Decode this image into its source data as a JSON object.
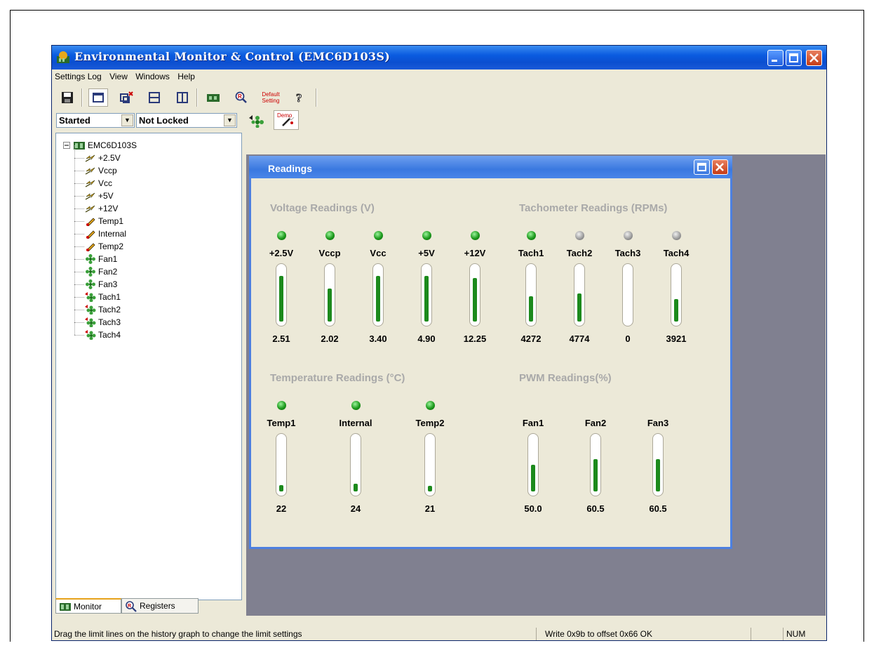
{
  "window": {
    "title": "Environmental Monitor & Control (EMC6D103S)"
  },
  "menu": [
    "Settings Log",
    "View",
    "Windows",
    "Help"
  ],
  "toolbar": {
    "default_setting_line1": "Default",
    "default_setting_line2": "Setting",
    "demo_label": "Demo"
  },
  "combos": {
    "state": "Started",
    "lock": "Not Locked"
  },
  "tree": {
    "root": "EMC6D103S",
    "items": [
      {
        "label": "+2.5V",
        "icon": "voltage-icon"
      },
      {
        "label": "Vccp",
        "icon": "voltage-icon"
      },
      {
        "label": "Vcc",
        "icon": "voltage-icon"
      },
      {
        "label": "+5V",
        "icon": "voltage-icon"
      },
      {
        "label": "+12V",
        "icon": "voltage-icon"
      },
      {
        "label": "Temp1",
        "icon": "thermometer-icon"
      },
      {
        "label": "Internal",
        "icon": "thermometer-icon"
      },
      {
        "label": "Temp2",
        "icon": "thermometer-icon"
      },
      {
        "label": "Fan1",
        "icon": "fan-icon"
      },
      {
        "label": "Fan2",
        "icon": "fan-icon"
      },
      {
        "label": "Fan3",
        "icon": "fan-icon"
      },
      {
        "label": "Tach1",
        "icon": "tach-icon"
      },
      {
        "label": "Tach2",
        "icon": "tach-icon"
      },
      {
        "label": "Tach3",
        "icon": "tach-icon"
      },
      {
        "label": "Tach4",
        "icon": "tach-icon"
      }
    ]
  },
  "tabs": [
    "Monitor",
    "Registers"
  ],
  "readings": {
    "title": "Readings",
    "voltage": {
      "heading": "Voltage Readings (V)",
      "items": [
        {
          "name": "+2.5V",
          "value": "2.51",
          "level": 0.85,
          "led": "green"
        },
        {
          "name": "Vccp",
          "value": "2.02",
          "level": 0.62,
          "led": "green"
        },
        {
          "name": "Vcc",
          "value": "3.40",
          "level": 0.86,
          "led": "green"
        },
        {
          "name": "+5V",
          "value": "4.90",
          "level": 0.85,
          "led": "green"
        },
        {
          "name": "+12V",
          "value": "12.25",
          "level": 0.82,
          "led": "green"
        }
      ]
    },
    "tach": {
      "heading": "Tachometer Readings (RPMs)",
      "items": [
        {
          "name": "Tach1",
          "value": "4272",
          "level": 0.48,
          "led": "green"
        },
        {
          "name": "Tach2",
          "value": "4774",
          "level": 0.52,
          "led": "gray"
        },
        {
          "name": "Tach3",
          "value": "0",
          "level": 0.0,
          "led": "gray"
        },
        {
          "name": "Tach4",
          "value": "3921",
          "level": 0.42,
          "led": "gray"
        }
      ]
    },
    "temperature": {
      "heading": "Temperature Readings (°C)",
      "items": [
        {
          "name": "Temp1",
          "value": "22",
          "level": 0.12,
          "led": "green"
        },
        {
          "name": "Internal",
          "value": "24",
          "level": 0.14,
          "led": "green"
        },
        {
          "name": "Temp2",
          "value": "21",
          "level": 0.1,
          "led": "green"
        }
      ]
    },
    "pwm": {
      "heading": "PWM Readings(%)",
      "items": [
        {
          "name": "Fan1",
          "value": "50.0",
          "level": 0.5,
          "led": "none"
        },
        {
          "name": "Fan2",
          "value": "60.5",
          "level": 0.6,
          "led": "none"
        },
        {
          "name": "Fan3",
          "value": "60.5",
          "level": 0.6,
          "led": "none"
        }
      ]
    }
  },
  "status": {
    "message": "Drag the limit lines on the history graph to change the limit settings",
    "write": "Write 0x9b to offset 0x66 OK",
    "num": "NUM"
  }
}
